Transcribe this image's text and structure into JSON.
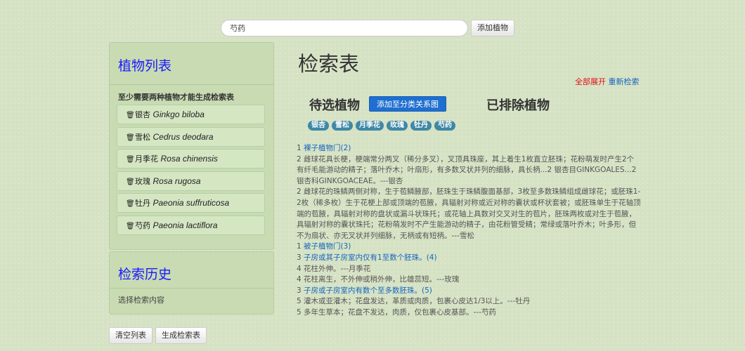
{
  "search": {
    "value": "芍药"
  },
  "add_plant_button": "添加植物",
  "plant_panel": {
    "title": "植物列表",
    "note": "至少需要两种植物才能生成检索表",
    "items": [
      {
        "cn": "银杏",
        "latin": "Ginkgo biloba"
      },
      {
        "cn": "雪松",
        "latin": "Cedrus deodara"
      },
      {
        "cn": "月季花",
        "latin": "Rosa chinensis"
      },
      {
        "cn": "玫瑰",
        "latin": "Rosa rugosa"
      },
      {
        "cn": "牡丹",
        "latin": "Paeonia suffruticosa"
      },
      {
        "cn": "芍药",
        "latin": "Paeonia lactiflora"
      }
    ]
  },
  "history_panel": {
    "title": "检索历史",
    "text": "选择检索内容"
  },
  "buttons": {
    "clear": "清空列表",
    "generate": "生成检索表"
  },
  "main": {
    "title": "检索表",
    "expand_all": "全部展开",
    "re_search": "重新检索",
    "candidates_title": "待选植物",
    "add_to_tree": "添加至分类关系图",
    "excluded_title": "已排除植物",
    "tags": [
      "银杏",
      "雪松",
      "月季花",
      "玫瑰",
      "牡丹",
      "芍药"
    ]
  },
  "key_lines": [
    {
      "prefix": "1 ",
      "link": "裸子植物门(2)",
      "text": ""
    },
    {
      "prefix": "",
      "link": "",
      "text": "2 雌球花具长梗，梗端常分两叉（稀分多叉），叉顶具珠座，其上着生1枚直立胚珠；花粉萌发时产生2个有纤毛能游动的精子；落叶乔木；叶扇形，有多数叉状并列的细脉，具长柄...2 银杏目GINKGOALES...2 银杏科GINKGOACEAE。---银杏"
    },
    {
      "prefix": "",
      "link": "",
      "text": "2 雌球花的珠鳞两侧对称，生于苞鳞腋部，胚珠生于珠鳞腹面基部，3枚至多数珠鳞组成雌球花；或胚珠1-2枚（稀多枚）生于花梗上部或顶端的苞腋，具辐射对称或近对称的囊状或杯状套被；或胚珠单生于花轴顶端的苞腋，具辐射对称的盘状或漏斗状珠托；或花轴上具数对交叉对生的苞片，胚珠两枚或对生于苞腋，具辐射对称的囊状珠托；花粉萌发时不产生能游动的精子，由花粉管受精；常绿或落叶乔木；叶多形，但不为扇状、亦无叉状并列细脉，无柄或有短柄。---雪松"
    },
    {
      "prefix": "1 ",
      "link": "被子植物门(3)",
      "text": ""
    },
    {
      "prefix": "3 ",
      "link": "子房或其子房室内仅有1至数个胚珠。(4)",
      "text": ""
    },
    {
      "prefix": "",
      "link": "",
      "text": "4 花柱外伸。---月季花"
    },
    {
      "prefix": "",
      "link": "",
      "text": "4 花柱离生，不外伸或稍外伸，比雄蕊短。---玫瑰"
    },
    {
      "prefix": "3 ",
      "link": "子房或子房室内有数个至多数胚珠。(5)",
      "text": ""
    },
    {
      "prefix": "",
      "link": "",
      "text": "5 灌木或亚灌木；花盘发达，革质或肉质，包裹心皮达1/3以上。---牡丹"
    },
    {
      "prefix": "",
      "link": "",
      "text": "5 多年生草本；花盘不发达，肉质，仅包裹心皮基部。---芍药"
    }
  ]
}
